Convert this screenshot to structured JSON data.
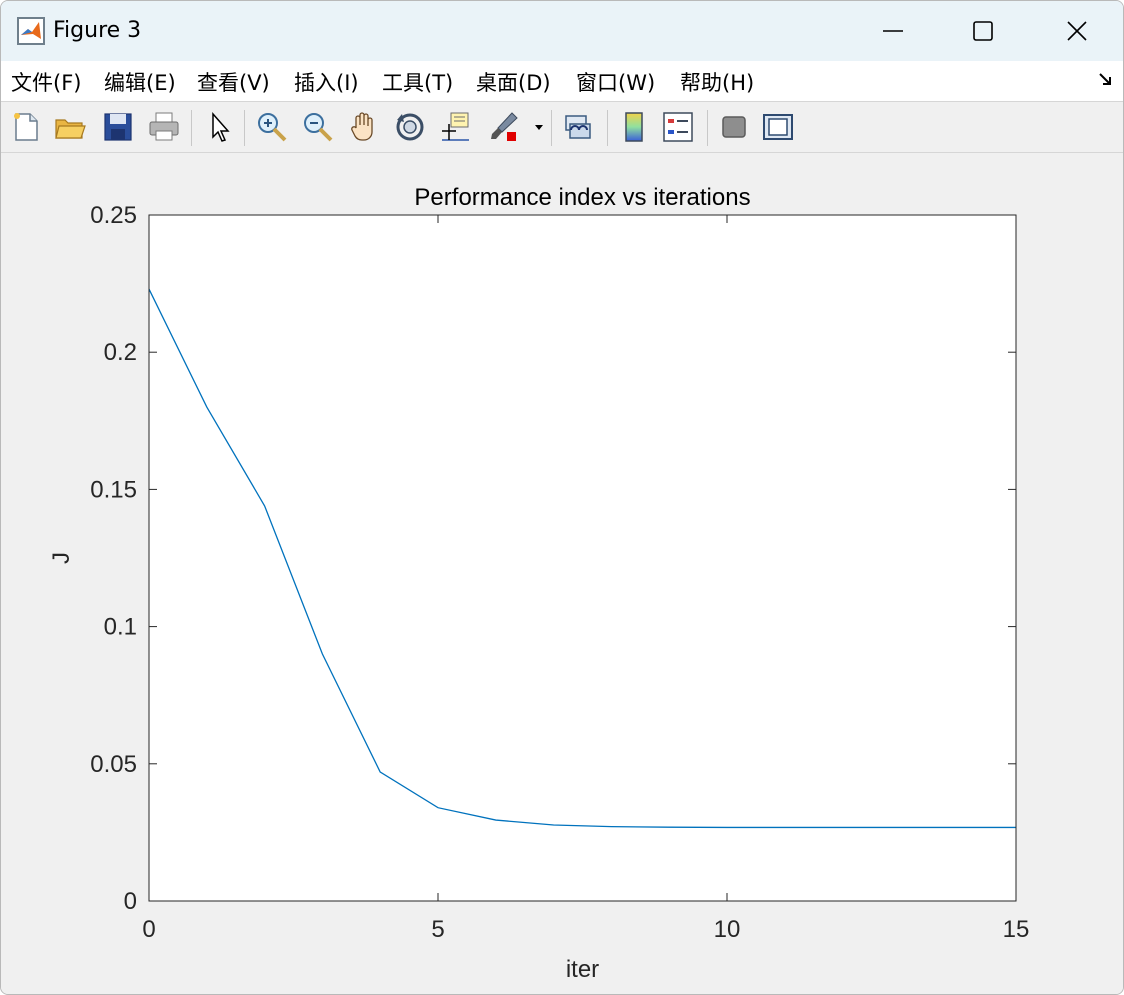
{
  "window": {
    "title": "Figure 3",
    "controls": {
      "minimize": "minimize",
      "maximize": "maximize",
      "close": "close"
    }
  },
  "menu": {
    "items": [
      "文件(F)",
      "编辑(E)",
      "查看(V)",
      "插入(I)",
      "工具(T)",
      "桌面(D)",
      "窗口(W)",
      "帮助(H)"
    ]
  },
  "toolbar": {
    "icons": [
      "new-figure-icon",
      "open-file-icon",
      "save-icon",
      "print-icon",
      "pointer-icon",
      "zoom-in-icon",
      "zoom-out-icon",
      "pan-hand-icon",
      "rotate-3d-icon",
      "data-cursor-icon",
      "brush-icon",
      "link-plot-icon",
      "colorbar-icon",
      "legend-icon",
      "hide-plot-tools-icon",
      "show-plot-tools-icon"
    ]
  },
  "chart_data": {
    "type": "line",
    "title": "Performance index vs iterations",
    "xlabel": "iter",
    "ylabel": "J",
    "xlim": [
      0,
      15
    ],
    "ylim": [
      0,
      0.25
    ],
    "xticks": [
      "0",
      "5",
      "10",
      "15"
    ],
    "yticks": [
      "0",
      "0.05",
      "0.1",
      "0.15",
      "0.2",
      "0.25"
    ],
    "grid": false,
    "color": "#0072bd",
    "x": [
      0,
      1,
      2,
      3,
      4,
      5,
      6,
      7,
      8,
      9,
      10,
      11,
      12,
      13,
      14,
      15
    ],
    "y": [
      0.223,
      0.18,
      0.144,
      0.09,
      0.047,
      0.034,
      0.0295,
      0.0277,
      0.0271,
      0.0269,
      0.0268,
      0.0268,
      0.0268,
      0.0268,
      0.0268,
      0.0268
    ]
  }
}
